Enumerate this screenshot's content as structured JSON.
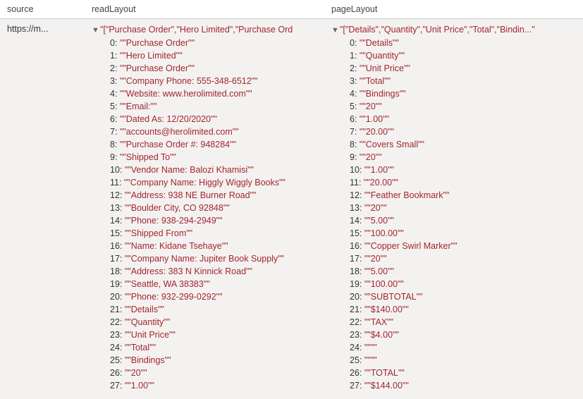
{
  "columns": {
    "source": "source",
    "readLayout": "readLayout",
    "pageLayout": "pageLayout"
  },
  "row": {
    "source_text": "https://m...",
    "readLayout": {
      "root": "\"[\"Purchase Order\",\"Hero Limited\",\"Purchase Ord",
      "items": [
        "\"\"Purchase Order\"\"",
        "\"\"Hero Limited\"\"",
        "\"\"Purchase Order\"\"",
        "\"\"Company Phone: 555-348-6512\"\"",
        "\"\"Website: www.herolimited.com\"\"",
        "\"\"Email:\"\"",
        "\"\"Dated As: 12/20/2020\"\"",
        "\"\"accounts@herolimited.com\"\"",
        "\"\"Purchase Order #: 948284\"\"",
        "\"\"Shipped To\"\"",
        "\"\"Vendor Name: Balozi Khamisi\"\"",
        "\"\"Company Name: Higgly Wiggly Books\"\"",
        "\"\"Address: 938 NE Burner Road\"\"",
        "\"\"Boulder City, CO 92848\"\"",
        "\"\"Phone: 938-294-2949\"\"",
        "\"\"Shipped From\"\"",
        "\"\"Name: Kidane Tsehaye\"\"",
        "\"\"Company Name: Jupiter Book Supply\"\"",
        "\"\"Address: 383 N Kinnick Road\"\"",
        "\"\"Seattle, WA 38383\"\"",
        "\"\"Phone: 932-299-0292\"\"",
        "\"\"Details\"\"",
        "\"\"Quantity\"\"",
        "\"\"Unit Price\"\"",
        "\"\"Total\"\"",
        "\"\"Bindings\"\"",
        "\"\"20\"\"",
        "\"\"1.00\"\""
      ]
    },
    "pageLayout": {
      "root": "\"[\"Details\",\"Quantity\",\"Unit Price\",\"Total\",\"Bindin...\"",
      "items": [
        "\"\"Details\"\"",
        "\"\"Quantity\"\"",
        "\"\"Unit Price\"\"",
        "\"\"Total\"\"",
        "\"\"Bindings\"\"",
        "\"\"20\"\"",
        "\"\"1.00\"\"",
        "\"\"20.00\"\"",
        "\"\"Covers Small\"\"",
        "\"\"20\"\"",
        "\"\"1.00\"\"",
        "\"\"20.00\"\"",
        "\"\"Feather Bookmark\"\"",
        "\"\"20\"\"",
        "\"\"5.00\"\"",
        "\"\"100.00\"\"",
        "\"\"Copper Swirl Marker\"\"",
        "\"\"20\"\"",
        "\"\"5.00\"\"",
        "\"\"100.00\"\"",
        "\"\"SUBTOTAL\"\"",
        "\"\"$140.00\"\"",
        "\"\"TAX\"\"",
        "\"\"$4.00\"\"",
        "\"\"\"\"",
        "\"\"\"\"",
        "\"\"TOTAL\"\"",
        "\"\"$144.00\"\""
      ]
    }
  }
}
